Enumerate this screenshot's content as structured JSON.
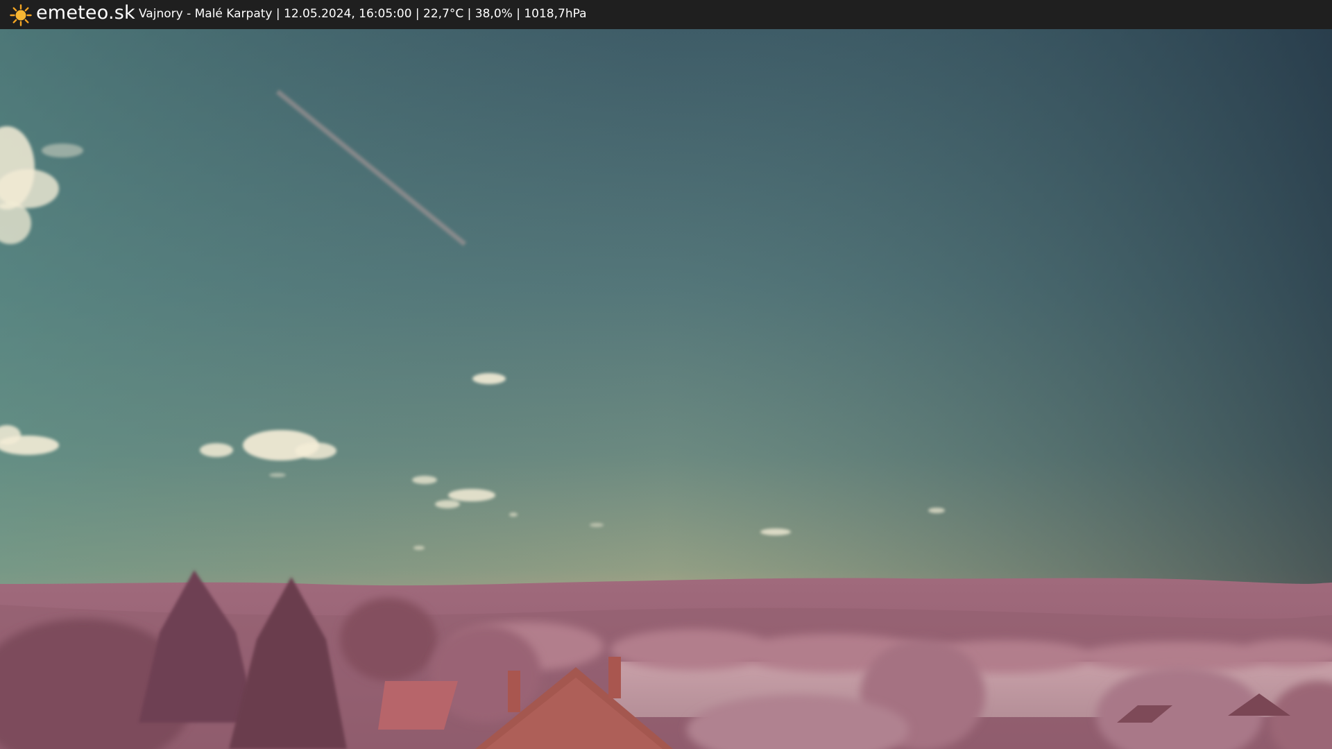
{
  "header": {
    "site_name": "emeteo.sk",
    "station_info": "Vajnory - Malé Karpaty | 12.05.2024, 16:05:00 | 22,7°C | 38,0% | 1018,7hPa"
  },
  "icons": {
    "logo": "sun-icon"
  },
  "colors": {
    "topbar": "#1f1f1f",
    "sun": "#f5a623",
    "sky_top": "#2f4250",
    "sky_bottom": "#8f9c80",
    "hills": "#a56f7f",
    "foliage": "#9a6070"
  }
}
